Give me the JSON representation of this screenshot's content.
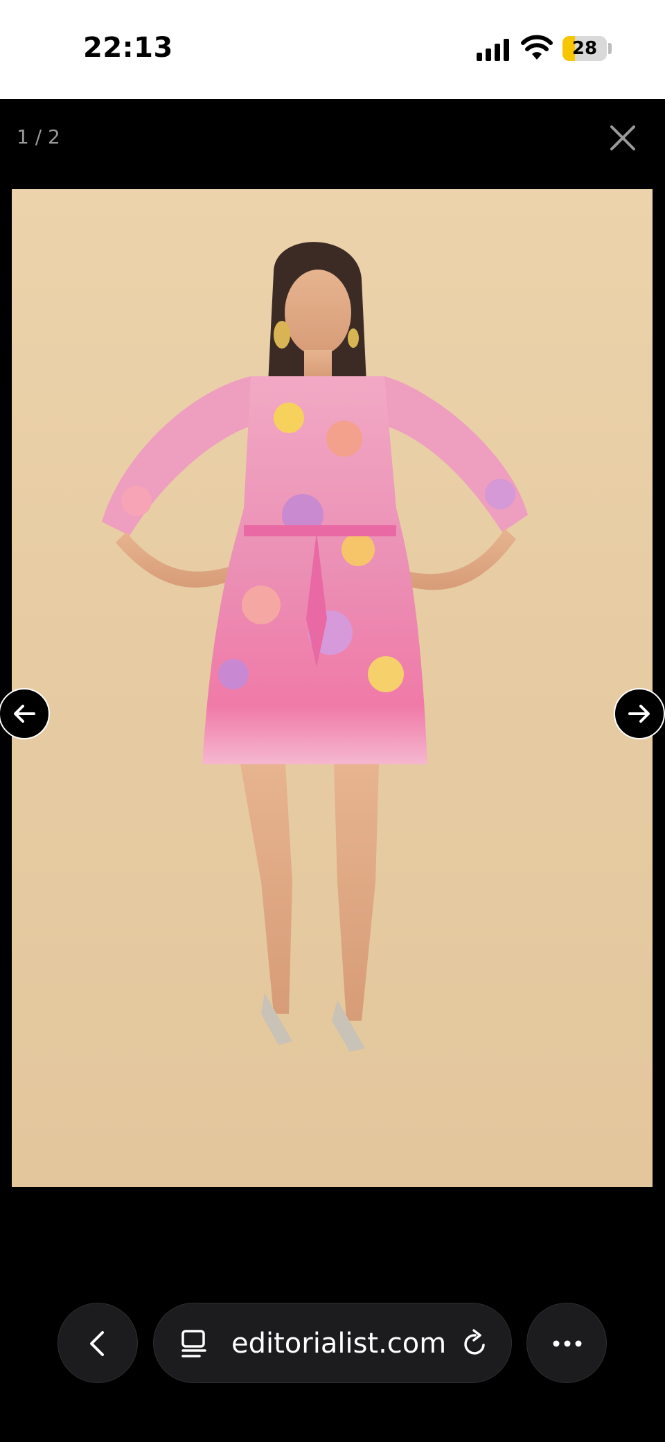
{
  "status_bar": {
    "time": "22:13",
    "battery_level": "28",
    "battery_fraction": 0.28,
    "icons": [
      "cellular-signal-icon",
      "wifi-icon",
      "battery-icon"
    ]
  },
  "viewer": {
    "counter": "1 / 2",
    "close_icon": "close-icon",
    "prev_icon": "arrow-left-icon",
    "next_icon": "arrow-right-icon",
    "photo_background": "#e8cfa6"
  },
  "browser": {
    "url": "editorialist.com",
    "back_icon": "chevron-left-icon",
    "reader_icon": "reader-mode-icon",
    "reload_icon": "reload-icon",
    "more_icon": "more-dots-icon"
  },
  "colors": {
    "accent_battery": "#f7c600",
    "toolbar_bg": "#1c1c1e"
  }
}
